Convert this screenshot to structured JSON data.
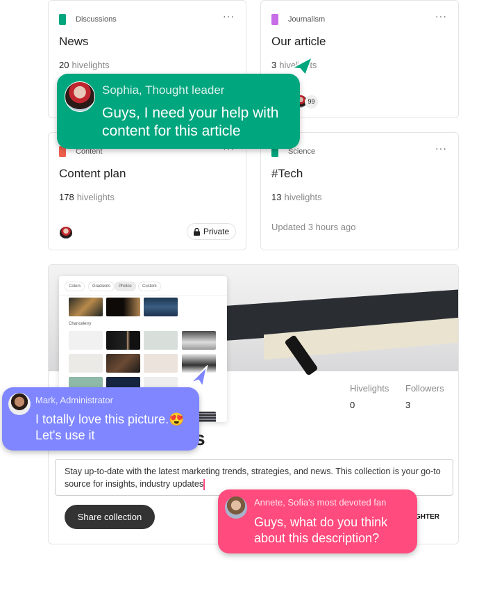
{
  "cards": [
    {
      "category": "Discussions",
      "color": "#00a67e",
      "title": "News",
      "count": "20",
      "count_label": "hivelights"
    },
    {
      "category": "Journalism",
      "color": "#c86de8",
      "title": "Our article",
      "count": "3",
      "count_label": "hivelights",
      "avatar_count": "99"
    },
    {
      "category": "Content",
      "color": "#f0604d",
      "title": "Content plan",
      "count": "178",
      "count_label": "hivelights",
      "private_label": "Private"
    },
    {
      "category": "Science",
      "color": "#00a67e",
      "title": "#Tech",
      "count": "13",
      "count_label": "hivelights",
      "updated": "Updated 3 hours ago"
    }
  ],
  "collection": {
    "title_visible": "s",
    "stats": [
      {
        "label": "Hivelights",
        "value": "0"
      },
      {
        "label": "Followers",
        "value": "3"
      }
    ],
    "description": "Stay up-to-date with the latest marketing trends, strategies, and news. This collection is your go-to source for insights, industry updates",
    "share_label": "Share collection",
    "partial_label": "GHTER"
  },
  "picker": {
    "tabs": [
      "Colors",
      "Gradients",
      "Photos",
      "Custom"
    ],
    "active_tab": "Photos",
    "section": "Chancelerry"
  },
  "bubbles": {
    "sophia": {
      "name": "Sophia, Thought leader",
      "text": "Guys, I need your help with content for this article",
      "color": "#00a67e"
    },
    "mark": {
      "name": "Mark, Administrator",
      "text": "I totally love this picture.😍 Let's use it",
      "color": "#7f86ff"
    },
    "annete": {
      "name": "Annete, Sofia's most devoted fan",
      "text": "Guys, what do you think about this description?",
      "color": "#ff4b7d"
    }
  }
}
